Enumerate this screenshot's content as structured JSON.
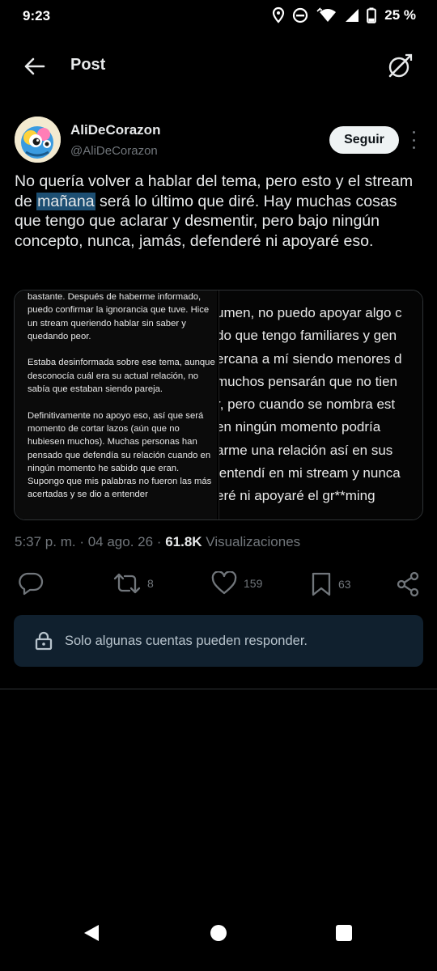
{
  "status_bar": {
    "time": "9:23",
    "battery": "25 %"
  },
  "header": {
    "title": "Post"
  },
  "author": {
    "name": "AliDeCorazon",
    "handle": "@AliDeCorazon",
    "follow_label": "Seguir"
  },
  "tweet": {
    "text_before": "No quería volver a hablar del tema, pero esto y el stream de ",
    "text_highlight": "mañana",
    "text_after": " será lo último que diré. Hay muchas cosas que tengo que aclarar y desmentir, pero bajo ningún concepto, nunca, jamás, defenderé ni apoyaré eso."
  },
  "media": {
    "left_paragraphs": [
      "bastante. Después de haberme informado, puedo confirmar la ignorancia que tuve. Hice un stream queriendo hablar sin saber y quedando peor.",
      "Estaba desinformada sobre ese tema, aunque desconocía cuál era su actual relación, no sabía que estaban siendo pareja.",
      "Definitivamente no apoyo eso, así que será momento de cortar lazos (aún que no hubiesen muchos). Muchas personas han pensado que defendía su relación cuando en ningún momento he sabido que eran. Supongo que mis palabras no fueron las más acertadas y se dio a entender"
    ],
    "right_lines": [
      "umen, no puedo apoyar algo c",
      "do que tengo familiares y gen",
      "ercana a mí siendo menores d",
      "muchos pensarán que no tien",
      "r, pero cuando se nombra est",
      "en ningún momento podría",
      "arme una relación así en sus",
      "lentendí en mi stream y nunca",
      "eré ni apoyaré el gr**ming"
    ]
  },
  "meta": {
    "time": "5:37 p. m.",
    "sep1": " · ",
    "date": "04 ago. 26",
    "sep2": " · ",
    "views_count": "61.8K",
    "views_label": " Visualizaciones"
  },
  "actions": {
    "reply_icon": "reply-icon",
    "retweet_count": "8",
    "like_count": "159",
    "bookmark_count": "63"
  },
  "reply_restriction": {
    "text": "Solo algunas cuentas pueden responder."
  }
}
